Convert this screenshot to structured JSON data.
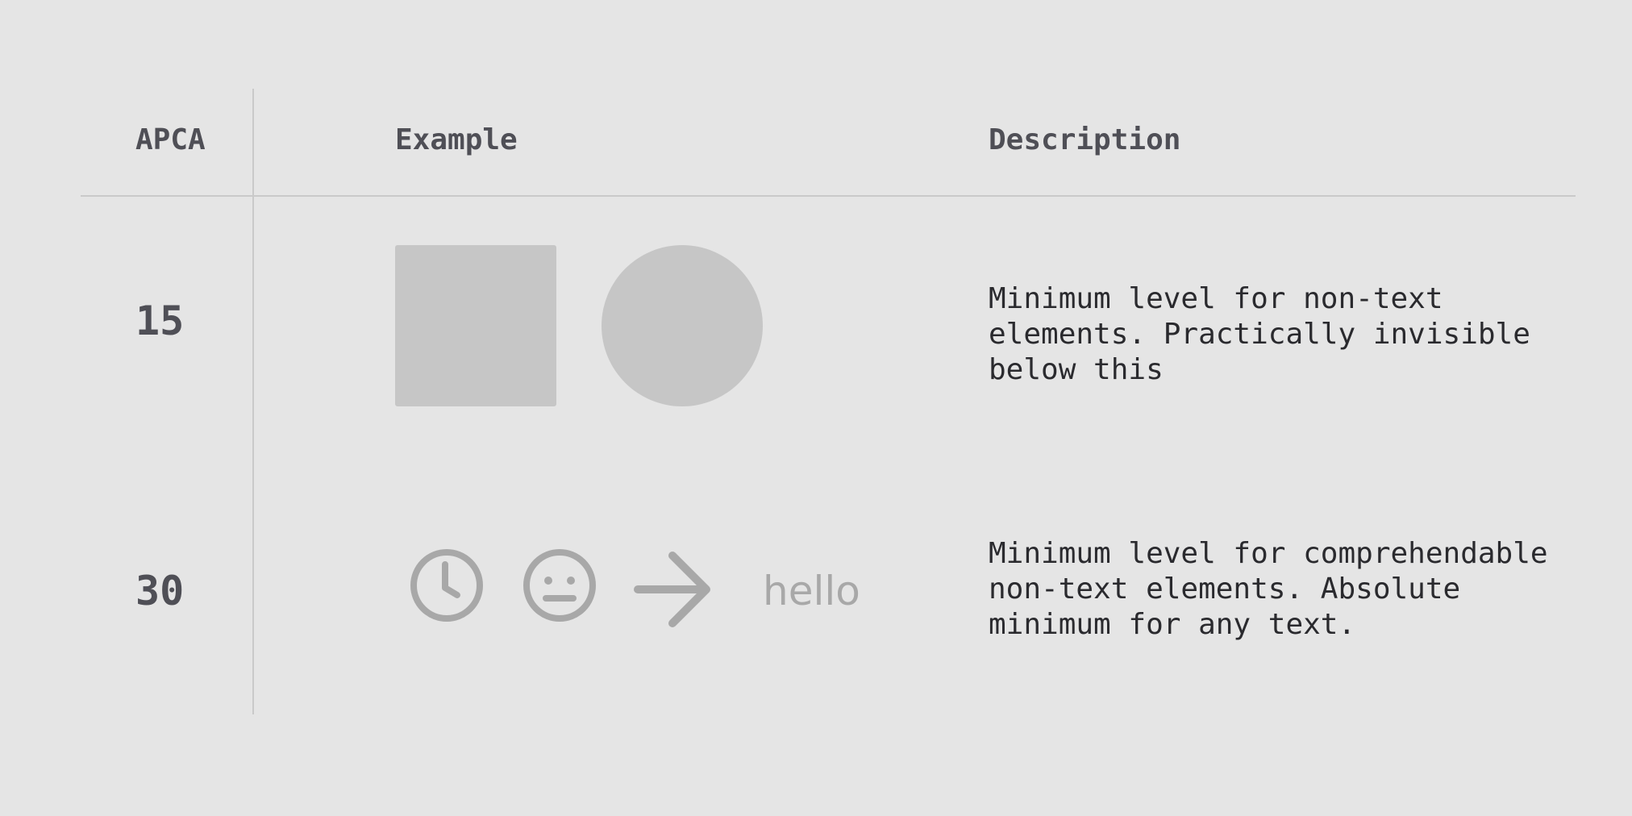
{
  "table": {
    "headers": {
      "apca": "APCA",
      "example": "Example",
      "description": "Description"
    },
    "rows": [
      {
        "apca": "15",
        "description": "Minimum level for non-text\nelements. Practically invisible\nbelow this"
      },
      {
        "apca": "30",
        "description": "Minimum level for comprehendable\nnon-text elements. Absolute\nminimum for any text.",
        "example_text": "hello"
      }
    ]
  },
  "icons": [
    "clock-icon",
    "neutral-face-icon",
    "arrow-right-icon"
  ],
  "colors": {
    "background": "#e5e5e5",
    "lines": "#c9c9c9",
    "shape_15": "#c6c6c6",
    "icon_30": "#a8a8a8",
    "heading_text": "#4f4f56",
    "body_text": "#2a2a2e"
  }
}
